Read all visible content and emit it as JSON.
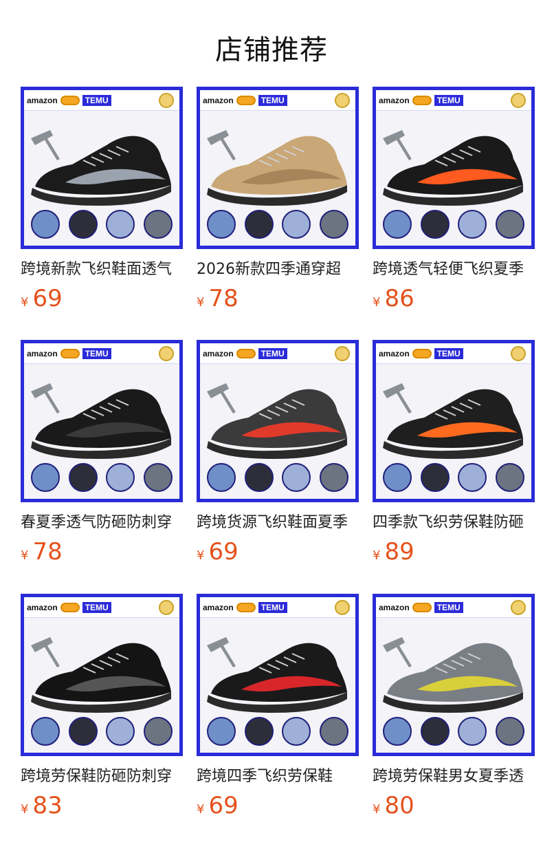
{
  "page": {
    "title": "店铺推荐"
  },
  "currency_symbol": "¥",
  "thumb_labels": {
    "brand_left": "amazon",
    "brand_right": "TEMU"
  },
  "products": [
    {
      "title": "跨境新款飞织鞋面透气",
      "price": "69",
      "shoe_color": "#1b1b1b",
      "accent": "#9aa3ad"
    },
    {
      "title": "2026新款四季通穿超",
      "price": "78",
      "shoe_color": "#c9a776",
      "accent": "#a8845a"
    },
    {
      "title": "跨境透气轻便飞织夏季",
      "price": "86",
      "shoe_color": "#1a1a1a",
      "accent": "#ff5a1f"
    },
    {
      "title": "春夏季透气防砸防刺穿",
      "price": "78",
      "shoe_color": "#1a1a1a",
      "accent": "#3a3a3a"
    },
    {
      "title": "跨境货源飞织鞋面夏季",
      "price": "69",
      "shoe_color": "#3b3b3b",
      "accent": "#e03a2a"
    },
    {
      "title": "四季款飞织劳保鞋防砸",
      "price": "89",
      "shoe_color": "#1f1f1f",
      "accent": "#ff6a1f"
    },
    {
      "title": "跨境劳保鞋防砸防刺穿",
      "price": "83",
      "shoe_color": "#141414",
      "accent": "#555555"
    },
    {
      "title": "跨境四季飞织劳保鞋",
      "price": "69",
      "shoe_color": "#1a1a1a",
      "accent": "#d8262a"
    },
    {
      "title": "跨境劳保鞋男女夏季透",
      "price": "80",
      "shoe_color": "#7a7f86",
      "accent": "#d9cf3a"
    }
  ]
}
